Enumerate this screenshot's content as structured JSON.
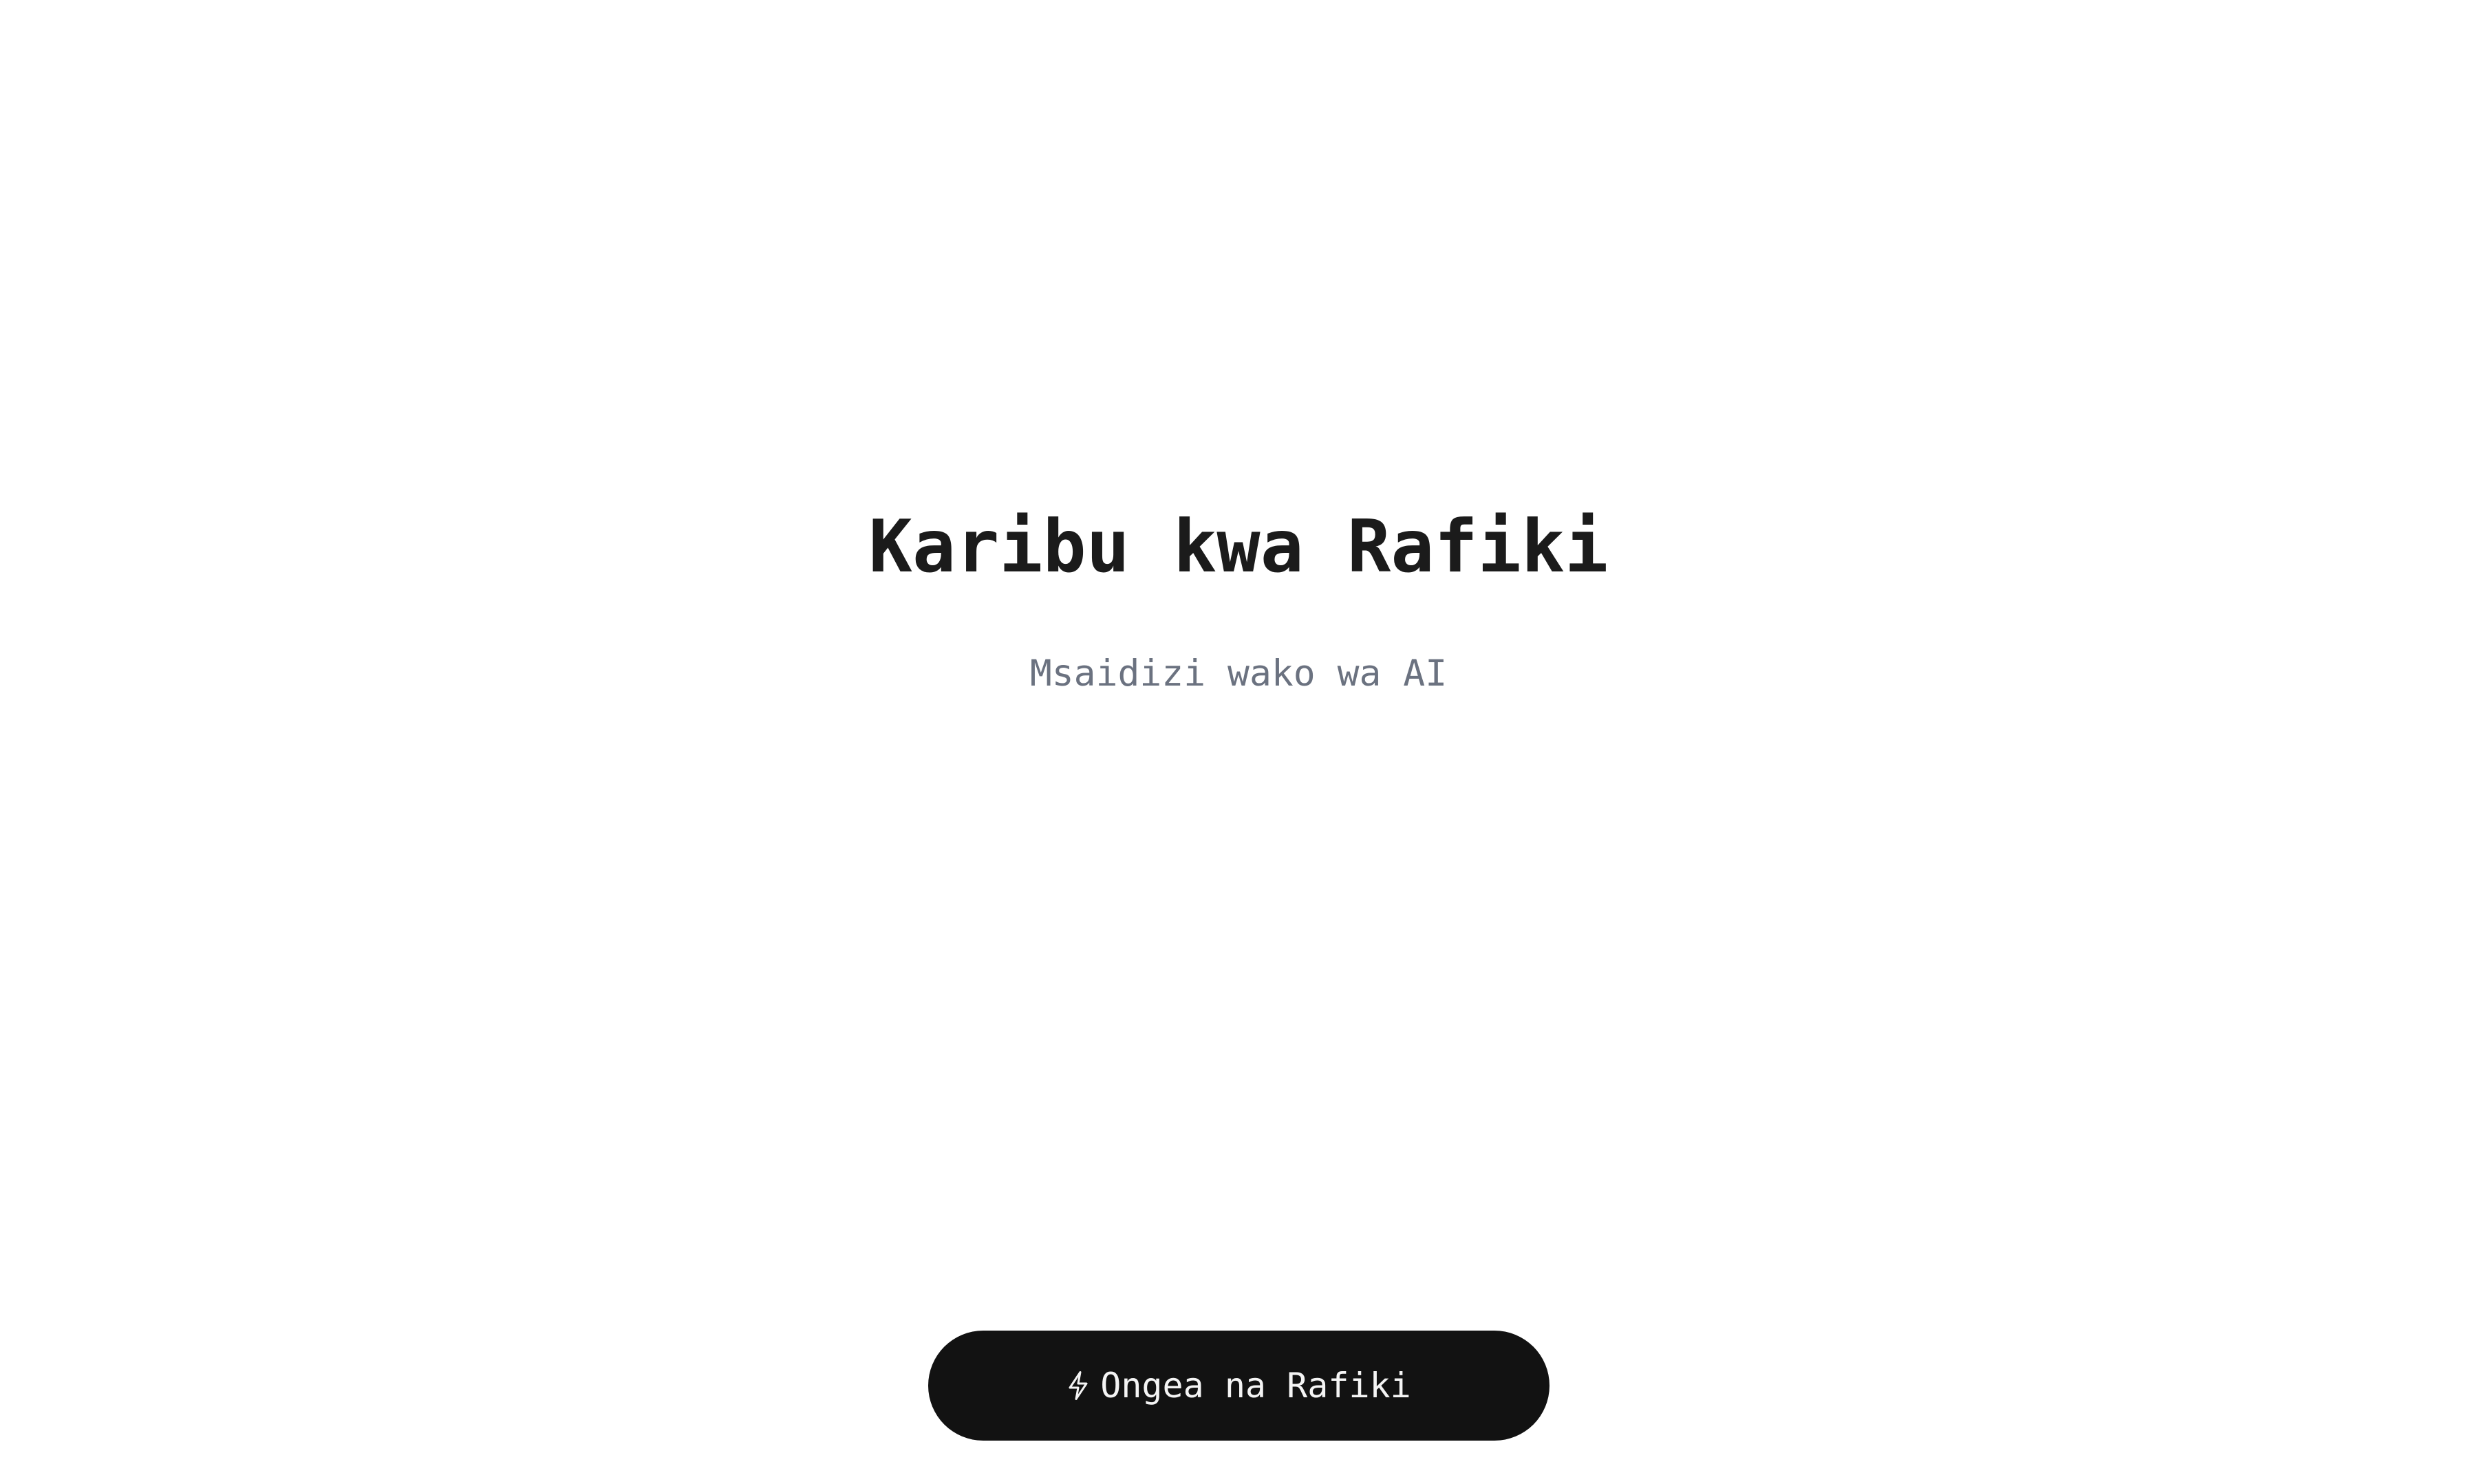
{
  "hero": {
    "title": "Karibu kwa Rafiki",
    "subtitle": "Msaidizi wako wa AI"
  },
  "cta": {
    "label": "Ongea na Rafiki",
    "icon": "lightning-icon"
  },
  "colors": {
    "background": "#ffffff",
    "title": "#1b1b1b",
    "subtitle": "#6b7280",
    "button_bg": "#121212",
    "button_text": "#f4f4f4"
  }
}
